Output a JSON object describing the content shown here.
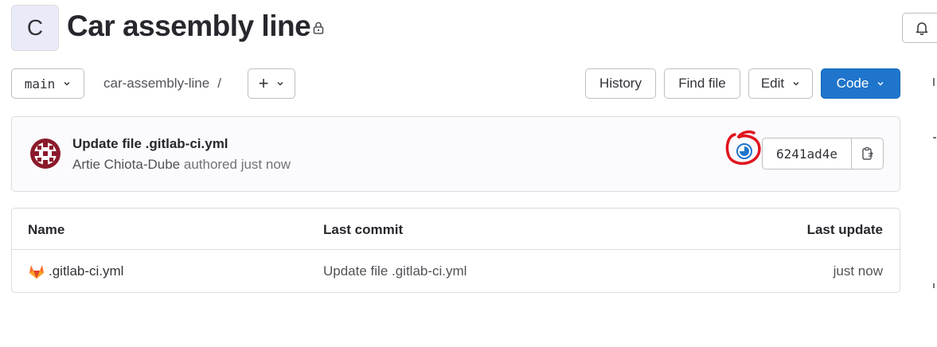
{
  "project": {
    "avatar_letter": "C",
    "title": "Car assembly line"
  },
  "toolbar": {
    "branch": "main",
    "breadcrumb_path": "car-assembly-line",
    "breadcrumb_sep": "/",
    "add_label": "+",
    "history_label": "History",
    "find_file_label": "Find file",
    "edit_label": "Edit",
    "code_label": "Code"
  },
  "commit": {
    "message": "Update file .gitlab-ci.yml",
    "author": "Artie Chiota-Dube",
    "authored_text": "authored just now",
    "sha": "6241ad4e",
    "pipeline_status": "running"
  },
  "table": {
    "headers": {
      "name": "Name",
      "last_commit": "Last commit",
      "last_update": "Last update"
    },
    "rows": [
      {
        "name": ".gitlab-ci.yml",
        "last_commit": "Update file .gitlab-ci.yml",
        "last_update": "just now"
      }
    ]
  },
  "colors": {
    "primary_button": "#1f75cb",
    "annotation_red": "#e0141e",
    "pipeline_running": "#1f75cb"
  }
}
